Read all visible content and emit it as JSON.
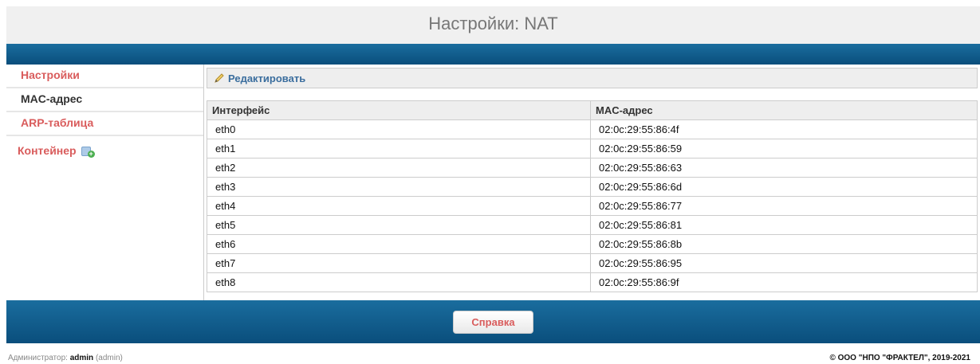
{
  "header": {
    "title": "Настройки: NAT"
  },
  "sidebar": {
    "items": [
      {
        "label": "Настройки"
      },
      {
        "label": "MAC-адрес"
      },
      {
        "label": "ARP-таблица"
      }
    ],
    "container": {
      "label": "Контейнер"
    }
  },
  "toolbar": {
    "edit_label": "Редактировать"
  },
  "table": {
    "columns": [
      "Интерфейс",
      "MAC-адрес"
    ],
    "rows": [
      [
        "eth0",
        "02:0c:29:55:86:4f"
      ],
      [
        "eth1",
        "02:0c:29:55:86:59"
      ],
      [
        "eth2",
        "02:0c:29:55:86:63"
      ],
      [
        "eth3",
        "02:0c:29:55:86:6d"
      ],
      [
        "eth4",
        "02:0c:29:55:86:77"
      ],
      [
        "eth5",
        "02:0c:29:55:86:81"
      ],
      [
        "eth6",
        "02:0c:29:55:86:8b"
      ],
      [
        "eth7",
        "02:0c:29:55:86:95"
      ],
      [
        "eth8",
        "02:0c:29:55:86:9f"
      ]
    ]
  },
  "help": {
    "label": "Справка"
  },
  "footer": {
    "admin_prefix": "Администратор:",
    "admin_name": "admin",
    "admin_role": "(admin)",
    "copyright": "© ООО \"НПО \"ФРАКТЕЛ\", 2019-2021"
  },
  "colors": {
    "accent_bar": "#0a4e7c",
    "link": "#d95c5c",
    "toolbar_link": "#3b6e9e"
  }
}
